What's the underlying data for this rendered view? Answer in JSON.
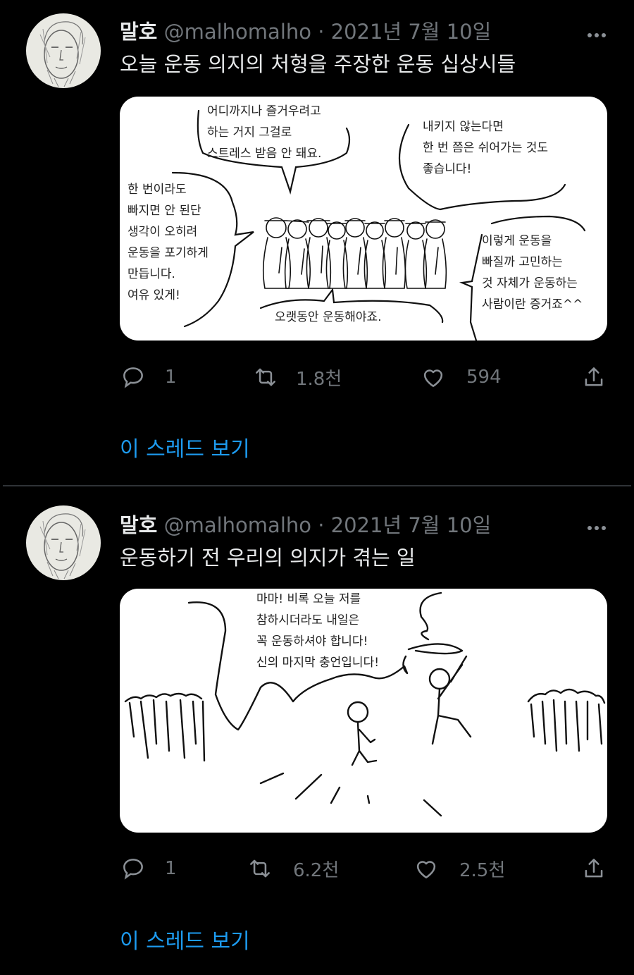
{
  "tweets": [
    {
      "name": "말호",
      "handle": "@malhomalho",
      "date": "· 2021년 7월 10일",
      "text": "오늘 운동 의지의 처형을 주장한 운동 십상시들",
      "comic": {
        "bubble_top": "어디까지나 즐거우려고\n하는 거지 그걸로\n스트레스 받음 안 돼요.",
        "bubble_right_top": "내키지 않는다면\n한 번 쯤은 쉬어가는 것도\n좋습니다!",
        "bubble_left": "한 번이라도\n빠지면 안 된단\n생각이 오히려\n운동을 포기하게\n만듭니다.\n여유 있게!",
        "bubble_bottom": "오랫동안 운동해야죠.",
        "bubble_right_bottom": "이렇게 운동을\n빠질까 고민하는\n것 자체가 운동하는\n사람이란 증거죠^^"
      },
      "actions": {
        "reply": "1",
        "retweet": "1.8천",
        "like": "594"
      },
      "thread_link": "이 스레드 보기"
    },
    {
      "name": "말호",
      "handle": "@malhomalho",
      "date": "· 2021년 7월 10일",
      "text": "운동하기 전 우리의 의지가 겪는 일",
      "comic": {
        "bubble_top": "마마! 비록 오늘 저를\n참하시더라도 내일은\n꼭 운동하셔야 합니다!\n신의 마지막 충언입니다!"
      },
      "actions": {
        "reply": "1",
        "retweet": "6.2천",
        "like": "2.5천"
      },
      "thread_link": "이 스레드 보기"
    }
  ],
  "icons": {
    "reply": "speech-bubble-icon",
    "retweet": "retweet-arrows-icon",
    "like": "heart-outline-icon",
    "share": "share-upload-icon",
    "more": "more-dots-icon"
  },
  "colors": {
    "background": "#000000",
    "link": "#1d9bf0",
    "meta": "#71767b",
    "divider": "#2f3336"
  }
}
